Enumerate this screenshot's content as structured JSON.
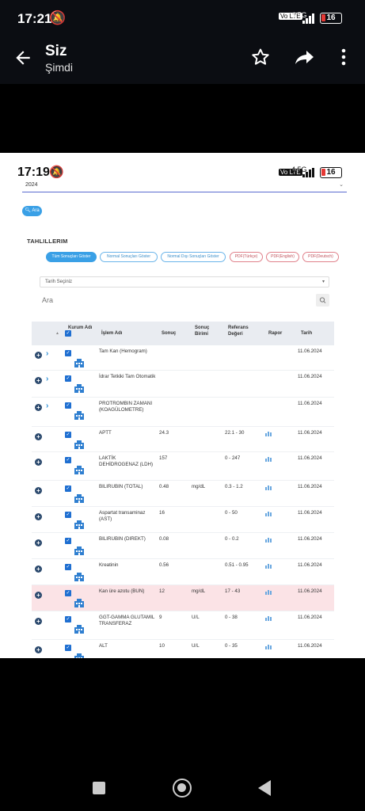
{
  "status_bar": {
    "time": "17:21",
    "network": "4.5G",
    "lte": "Vo LTE",
    "battery": "16"
  },
  "app_bar": {
    "title": "Siz",
    "subtitle": "Şimdi"
  },
  "inner": {
    "status_bar": {
      "time": "17:19",
      "network": "4.5G",
      "lte": "Vo LTE",
      "battery": "16"
    },
    "year_select": {
      "value": "2024"
    },
    "search_button": "Ara",
    "section_title": "TAHLILLERIM",
    "filter_pills": [
      {
        "label": "Tüm Sonuçları Göster",
        "style": "active"
      },
      {
        "label": "Normal Sonuçları Göster",
        "style": "blue"
      },
      {
        "label": "Normal Dışı Sonuçları Göster",
        "style": "blue"
      },
      {
        "label": "PDF(Türkçe)",
        "style": "red"
      },
      {
        "label": "PDF(English)",
        "style": "red"
      },
      {
        "label": "PDF(Deutsch)",
        "style": "red"
      }
    ],
    "date_select": {
      "placeholder": "Tarih Seçiniz"
    },
    "search_input": {
      "placeholder": "Ara"
    },
    "table": {
      "headers": {
        "kurum": "Kurum Adı",
        "islem": "İşlem Adı",
        "sonuc": "Sonuç",
        "birim": "Sonuç Birimi",
        "referans": "Referans Değeri",
        "rapor": "Rapor",
        "tarih": "Tarih"
      },
      "rows": [
        {
          "islem": "Tam Kan (Hemogram)",
          "sonuc": "",
          "birim": "",
          "referans": "",
          "tarih": "11.06.2024",
          "expand": true,
          "rapor": false,
          "highlight": false
        },
        {
          "islem": "İdrar Tetkiki Tam Otomatik",
          "sonuc": "",
          "birim": "",
          "referans": "",
          "tarih": "11.06.2024",
          "expand": true,
          "rapor": false,
          "highlight": false
        },
        {
          "islem": "PROTROMBIN ZAMANI (KOAGÜLOMETRE)",
          "sonuc": "",
          "birim": "",
          "referans": "",
          "tarih": "11.06.2024",
          "expand": true,
          "rapor": false,
          "highlight": false
        },
        {
          "islem": "APTT",
          "sonuc": "24.3",
          "birim": "",
          "referans": "22.1 - 30",
          "tarih": "11.06.2024",
          "expand": false,
          "rapor": true,
          "highlight": false
        },
        {
          "islem": "LAKTİK DEHİDROGENAZ (LDH)",
          "sonuc": "157",
          "birim": "",
          "referans": "0 - 247",
          "tarih": "11.06.2024",
          "expand": false,
          "rapor": true,
          "highlight": false
        },
        {
          "islem": "BILIRUBIN (TOTAL)",
          "sonuc": "0.48",
          "birim": "mg/dL",
          "referans": "0.3 - 1.2",
          "tarih": "11.06.2024",
          "expand": false,
          "rapor": true,
          "highlight": false
        },
        {
          "islem": "Aspartat transaminaz (AST)",
          "sonuc": "16",
          "birim": "",
          "referans": "0 - 50",
          "tarih": "11.06.2024",
          "expand": false,
          "rapor": true,
          "highlight": false
        },
        {
          "islem": "BILIRUBIN (DIREKT)",
          "sonuc": "0.08",
          "birim": "",
          "referans": "0 - 0.2",
          "tarih": "11.06.2024",
          "expand": false,
          "rapor": true,
          "highlight": false
        },
        {
          "islem": "Kreatinin",
          "sonuc": "0.56",
          "birim": "",
          "referans": "0.51 - 0.95",
          "tarih": "11.06.2024",
          "expand": false,
          "rapor": true,
          "highlight": false
        },
        {
          "islem": "Kan üre azotu (BUN)",
          "sonuc": "12",
          "birim": "mg/dL",
          "referans": "17 - 43",
          "tarih": "11.06.2024",
          "expand": false,
          "rapor": true,
          "highlight": true
        },
        {
          "islem": "GGT-GAMMA GLUTAMIL TRANSFERAZ",
          "sonuc": "9",
          "birim": "U/L",
          "referans": "0 - 38",
          "tarih": "11.06.2024",
          "expand": false,
          "rapor": true,
          "highlight": false
        },
        {
          "islem": "ALT",
          "sonuc": "10",
          "birim": "U/L",
          "referans": "0 - 35",
          "tarih": "11.06.2024",
          "expand": false,
          "rapor": true,
          "highlight": false
        }
      ]
    }
  }
}
